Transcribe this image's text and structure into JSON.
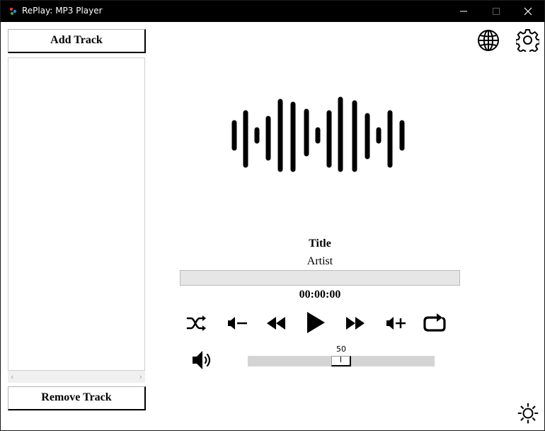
{
  "window": {
    "title": "RePlay: MP3 Player"
  },
  "sidebar": {
    "add_label": "Add Track",
    "remove_label": "Remove Track",
    "tracks": []
  },
  "now_playing": {
    "title": "Title",
    "artist": "Artist",
    "elapsed": "00:00:00",
    "progress": 0
  },
  "controls": {
    "icons": [
      "shuffle-icon",
      "volume-down-icon",
      "rewind-icon",
      "play-icon",
      "fast-forward-icon",
      "volume-up-icon",
      "repeat-icon"
    ]
  },
  "volume": {
    "value": "50",
    "level": 0.5,
    "min": 0,
    "max": 100
  },
  "top_icons": [
    "globe-icon",
    "gear-icon"
  ],
  "theme_icon": "sun-icon",
  "colors": {
    "titlebar": "#000000",
    "accent": "#000000",
    "track_bg": "#d4d4d4",
    "progress_bg": "#e6e6e6"
  }
}
